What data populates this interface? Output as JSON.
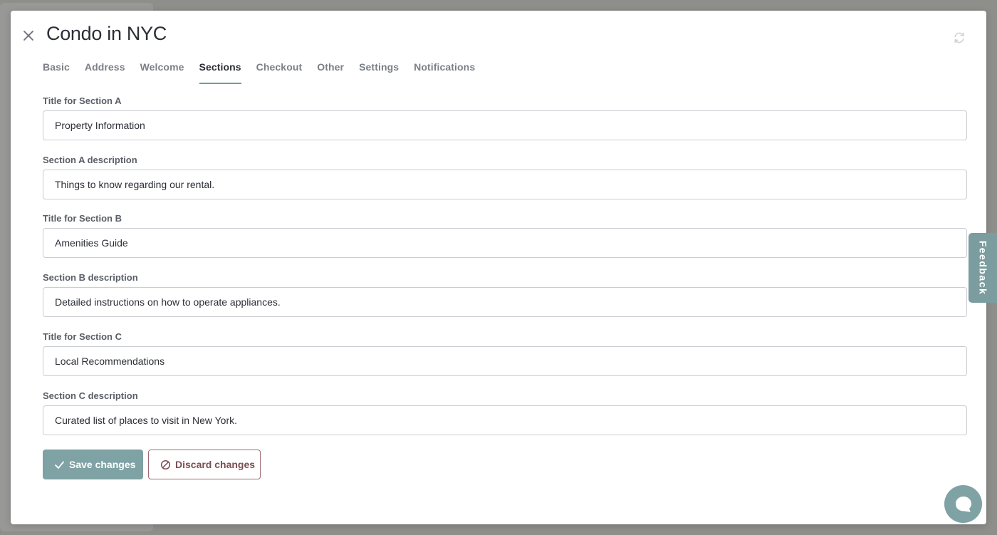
{
  "modal": {
    "title": "Condo in NYC",
    "close_icon": "close-icon",
    "refresh_icon": "refresh-icon"
  },
  "tabs": [
    {
      "label": "Basic",
      "active": false
    },
    {
      "label": "Address",
      "active": false
    },
    {
      "label": "Welcome",
      "active": false
    },
    {
      "label": "Sections",
      "active": true
    },
    {
      "label": "Checkout",
      "active": false
    },
    {
      "label": "Other",
      "active": false
    },
    {
      "label": "Settings",
      "active": false
    },
    {
      "label": "Notifications",
      "active": false
    }
  ],
  "fields": [
    {
      "label": "Title for Section A",
      "value": "Property Information"
    },
    {
      "label": "Section A description",
      "value": "Things to know regarding our rental."
    },
    {
      "label": "Title for Section B",
      "value": "Amenities Guide"
    },
    {
      "label": "Section B description",
      "value": "Detailed instructions on how to operate appliances."
    },
    {
      "label": "Title for Section C",
      "value": "Local Recommendations"
    },
    {
      "label": "Section C description",
      "value": "Curated list of places to visit in New York."
    }
  ],
  "actions": {
    "save_label": "Save changes",
    "save_icon": "check-icon",
    "discard_label": "Discard changes",
    "discard_icon": "ban-icon"
  },
  "feedback": {
    "label": "Feedback"
  },
  "chat": {
    "icon": "chat-icon"
  },
  "colors": {
    "accent": "#7fa2a4",
    "active_tab_underline": "#6e9e9c",
    "discard_border": "#9f6b73",
    "overlay": "#8e8f8b"
  }
}
